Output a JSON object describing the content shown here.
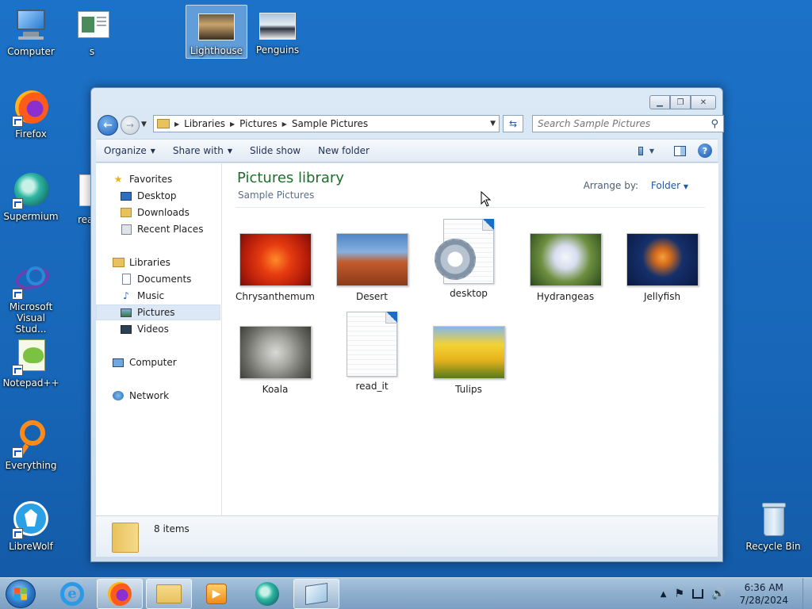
{
  "desktop": {
    "icons": [
      {
        "label": "Computer"
      },
      {
        "label": "s"
      },
      {
        "label": "Lighthouse"
      },
      {
        "label": "Penguins"
      },
      {
        "label": "Firefox"
      },
      {
        "label": "Supermium"
      },
      {
        "label": "rea"
      },
      {
        "label": "Microsoft Visual Stud..."
      },
      {
        "label": "Notepad++"
      },
      {
        "label": "Everything"
      },
      {
        "label": "LibreWolf"
      },
      {
        "label": "Recycle Bin"
      }
    ]
  },
  "window": {
    "address": {
      "crumbs": [
        "Libraries",
        "Pictures",
        "Sample Pictures"
      ]
    },
    "search": {
      "placeholder": "Search Sample Pictures"
    },
    "toolbar": {
      "organize": "Organize",
      "share_with": "Share with",
      "slide_show": "Slide show",
      "new_folder": "New folder"
    },
    "nav": {
      "favorites": "Favorites",
      "desktop": "Desktop",
      "downloads": "Downloads",
      "recent_places": "Recent Places",
      "libraries": "Libraries",
      "documents": "Documents",
      "music": "Music",
      "pictures": "Pictures",
      "videos": "Videos",
      "computer": "Computer",
      "network": "Network"
    },
    "content": {
      "title": "Pictures library",
      "subtitle": "Sample Pictures",
      "arrange_label": "Arrange by:",
      "arrange_value": "Folder",
      "items": [
        {
          "name": "Chrysanthemum"
        },
        {
          "name": "Desert"
        },
        {
          "name": "desktop"
        },
        {
          "name": "Hydrangeas"
        },
        {
          "name": "Jellyfish"
        },
        {
          "name": "Koala"
        },
        {
          "name": "read_it"
        },
        {
          "name": "Tulips"
        }
      ]
    },
    "details": {
      "count": "8 items"
    }
  },
  "taskbar": {
    "time": "6:36 AM",
    "date": "7/28/2024"
  },
  "colors": {
    "desktop_bg": "#1766b8",
    "library_title": "#1e6d2d",
    "link_blue": "#1f5aa7"
  }
}
